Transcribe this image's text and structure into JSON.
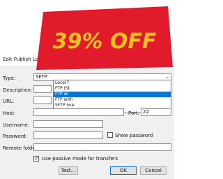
{
  "window": {
    "title": "Edit Publish Loca",
    "close_icon": "close-icon"
  },
  "form": {
    "type_label": "Type:",
    "type_value": "SFTP",
    "description_label": "Description:",
    "url_label": "URL:",
    "host_label": "Host:",
    "port_label": "Port:",
    "port_value": "22",
    "username_label": "Username:",
    "password_label": "Password:",
    "show_password_label": "Show password",
    "remote_folder_label": "Remote folder:",
    "passive_mode_label": "Use passive mode for transfers"
  },
  "dropdown": {
    "options": [
      "Local f",
      "FTP (St",
      "FTP wi",
      "FTP with",
      "SFTP ove"
    ]
  },
  "buttons": {
    "test": "Test...",
    "ok": "OK",
    "cancel": "Cancel"
  },
  "promo": {
    "headline": "39% OFF",
    "colors": {
      "badge": "#e11b2b",
      "text": "#f6c21c"
    }
  }
}
